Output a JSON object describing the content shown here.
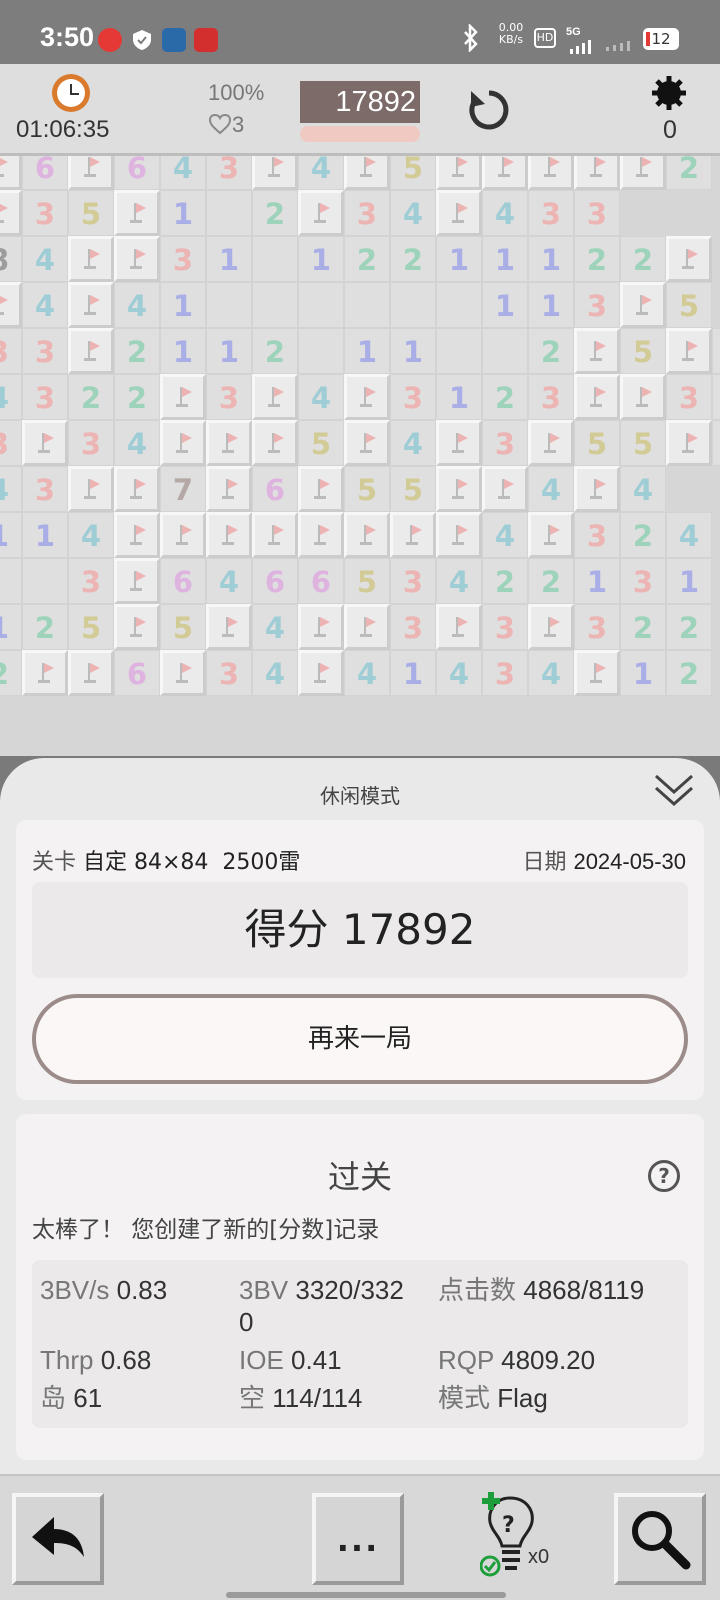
{
  "status_bar": {
    "time": "3:50",
    "net_speed_value": "0.00",
    "net_speed_unit": "KB/s",
    "hd_label": "HD",
    "signal_label": "5G",
    "battery": "12"
  },
  "game_bar": {
    "timer": "01:06:35",
    "progress": "100%",
    "lives": "3",
    "score": "17892",
    "mines_left": "0"
  },
  "colors": {
    "accent": "#7c6b68",
    "n1": "#6b76d4",
    "n2": "#59b48a",
    "n3": "#e07e7e",
    "n4": "#5aa9b8",
    "n5": "#b3a54a",
    "n6": "#c77cc9",
    "n7": "#7d6a63"
  },
  "board": {
    "rows": [
      "F6F643F4F5FFFFF2",
      "F35F1 2F34F433",
      "84FF31 12211122F",
      "F4F41      113F5",
      "33F2112 11  2F5F4",
      "4322F3F4F3123FF33",
      "3F34FFF5F4F3F55F3",
      "43FF7F6F55FF4F4",
      "114FFFFFFFF4F324",
      "  3F646653422131",
      "125F5F4FF3F3F322",
      "2FF6F34F41434F12"
    ]
  },
  "result": {
    "mode_title": "休闲模式",
    "level_label": "关卡",
    "level_value": "自定 84×84  2500雷",
    "date_label": "日期",
    "date_value": "2024-05-30",
    "score_text": "得分 17892",
    "again_label": "再来一局",
    "pass_title": "过关",
    "help_glyph": "?",
    "record_text": "太棒了！ 您创建了新的[分数]记录",
    "stats": [
      {
        "label": "3BV/s",
        "value": "0.83"
      },
      {
        "label": "3BV",
        "value": "3320/332"
      },
      {
        "label": "点击数",
        "value": "4868/8119"
      },
      {
        "label": "Thrp",
        "value": "0.68"
      },
      {
        "label": "IOE",
        "value": "0.41"
      },
      {
        "label": "RQP",
        "value": "4809.20"
      },
      {
        "label": "岛",
        "value": "61"
      },
      {
        "label": "空",
        "value": "114/114"
      },
      {
        "label": "模式",
        "value": "Flag"
      }
    ],
    "stat_wrap": "0"
  },
  "toolbar": {
    "more_label": "...",
    "hint_count": "x0"
  }
}
